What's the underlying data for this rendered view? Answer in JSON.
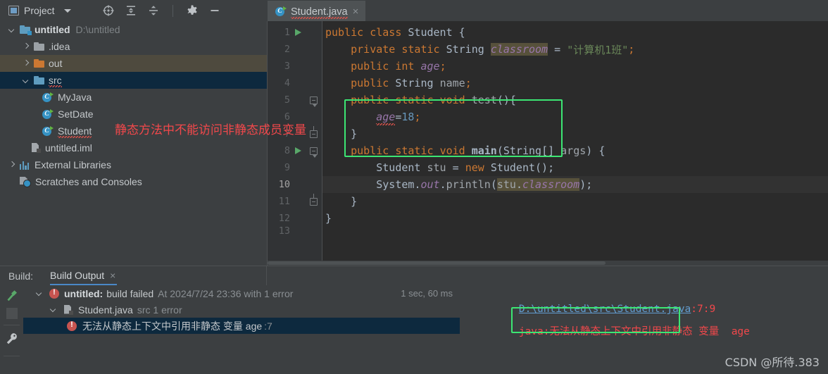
{
  "toolbar": {
    "project_label": "Project",
    "icons": [
      "project-icon",
      "chevron-down-icon",
      "locate-icon",
      "expand-all-icon",
      "collapse-all-icon",
      "gear-icon",
      "minimize-icon"
    ]
  },
  "editor_tab": {
    "filename": "Student.java",
    "close_label": "×",
    "icon": "java-class-icon"
  },
  "project_tree": [
    {
      "depth": 0,
      "arrow": "down",
      "icon": "module-folder-icon",
      "label": "untitled",
      "bold": true,
      "path": "D:\\untitled",
      "state": "normal"
    },
    {
      "depth": 1,
      "arrow": "right",
      "icon": "folder-gray-icon",
      "label": ".idea",
      "bold": false,
      "path": "",
      "state": "normal"
    },
    {
      "depth": 1,
      "arrow": "right",
      "icon": "folder-orange-icon",
      "label": "out",
      "bold": false,
      "path": "",
      "state": "hover"
    },
    {
      "depth": 1,
      "arrow": "down",
      "icon": "folder-blue-icon",
      "label": "src",
      "bold": false,
      "path": "",
      "state": "selected",
      "squiggle": true
    },
    {
      "depth": 2,
      "arrow": "none",
      "icon": "java-class-icon",
      "label": "MyJava",
      "bold": false,
      "path": "",
      "state": "normal"
    },
    {
      "depth": 2,
      "arrow": "none",
      "icon": "java-class-icon",
      "label": "SetDate",
      "bold": false,
      "path": "",
      "state": "normal"
    },
    {
      "depth": 2,
      "arrow": "none",
      "icon": "java-class-icon",
      "label": "Student",
      "bold": false,
      "path": "",
      "state": "normal",
      "squiggle": true
    },
    {
      "depth": 1,
      "arrow": "none",
      "icon": "iml-file-icon",
      "label": "untitled.iml",
      "bold": false,
      "path": "",
      "state": "normal"
    },
    {
      "depth": 0,
      "arrow": "right",
      "icon": "libraries-icon",
      "label": "External Libraries",
      "bold": false,
      "path": "",
      "state": "normal"
    },
    {
      "depth": 0,
      "arrow": "none",
      "icon": "scratches-icon",
      "label": "Scratches and Consoles",
      "bold": false,
      "path": "",
      "state": "normal"
    }
  ],
  "code": {
    "lines": [
      {
        "n": "1",
        "run": true,
        "fold": "none",
        "current": false
      },
      {
        "n": "2",
        "run": false,
        "fold": "none",
        "current": false
      },
      {
        "n": "3",
        "run": false,
        "fold": "none",
        "current": false
      },
      {
        "n": "4",
        "run": false,
        "fold": "none",
        "current": false
      },
      {
        "n": "5",
        "run": false,
        "fold": "start",
        "current": false
      },
      {
        "n": "6",
        "run": false,
        "fold": "none",
        "current": false
      },
      {
        "n": "7",
        "run": false,
        "fold": "end",
        "current": false
      },
      {
        "n": "8",
        "run": true,
        "fold": "start",
        "current": false
      },
      {
        "n": "9",
        "run": false,
        "fold": "none",
        "current": false
      },
      {
        "n": "10",
        "run": false,
        "fold": "none",
        "current": true
      },
      {
        "n": "11",
        "run": false,
        "fold": "end",
        "current": false
      },
      {
        "n": "12",
        "run": false,
        "fold": "none",
        "current": false
      },
      {
        "n": "13",
        "run": false,
        "fold": "none",
        "current": false
      }
    ],
    "text": {
      "l1": "public class Student {",
      "l2": "private static String classroom = \"计算机1班\";",
      "l3": "public int age;",
      "l4": "public String name;",
      "l5": "public static void test(){",
      "l6": "age=18;",
      "l7": "}",
      "l8": "public static void main(String[] args) {",
      "l9": "Student stu = new Student();",
      "l10": "System.out.println(stu.classroom);",
      "l11": "}",
      "l12": "}"
    },
    "tokens": {
      "public": "public",
      "class": "class",
      "private": "private",
      "static": "static",
      "void": "void",
      "int": "int",
      "new": "new",
      "String": "String",
      "Student": "Student",
      "System": "System",
      "out": "out",
      "println": "println",
      "classroom": "classroom",
      "age": "age",
      "name": "name",
      "test": "test",
      "main": "main",
      "stu": "stu",
      "args": "args",
      "string_literal": "\"计算机1班\"",
      "number_18": "18"
    }
  },
  "annotations": {
    "editor_note": "静态方法中不能访问非静态成员变量",
    "box_color": "#3CE673",
    "note_color": "#F2484B"
  },
  "build_panel": {
    "header_label": "Build:",
    "tab_label": "Build Output",
    "tab_close": "×",
    "rail_icons": [
      "build-hammer-icon",
      "stop-icon",
      "wrench-icon"
    ],
    "rows": [
      {
        "arrow": "down",
        "icon": "error-icon",
        "title": "untitled:",
        "text": "build failed",
        "meta": "At 2024/7/24 23:36 with 1 error",
        "time": "1 sec, 60 ms",
        "selected": false,
        "indent": 0
      },
      {
        "arrow": "down",
        "icon": "java-file-icon",
        "title": "",
        "text": "Student.java",
        "meta": "src 1 error",
        "time": "",
        "selected": false,
        "indent": 1
      },
      {
        "arrow": "none",
        "icon": "error-icon",
        "title": "",
        "text": "无法从静态上下文中引用非静态 变量 age",
        "meta": ":7",
        "time": "",
        "selected": true,
        "indent": 2
      }
    ],
    "detail": {
      "path_link": "D:\\untitled\\src\\Student.java",
      "path_pos": ":7:9",
      "prefix": "java:",
      "message": "无法从静态上下文中引用非静态 变量  age"
    }
  },
  "watermark": "CSDN @所待.383"
}
